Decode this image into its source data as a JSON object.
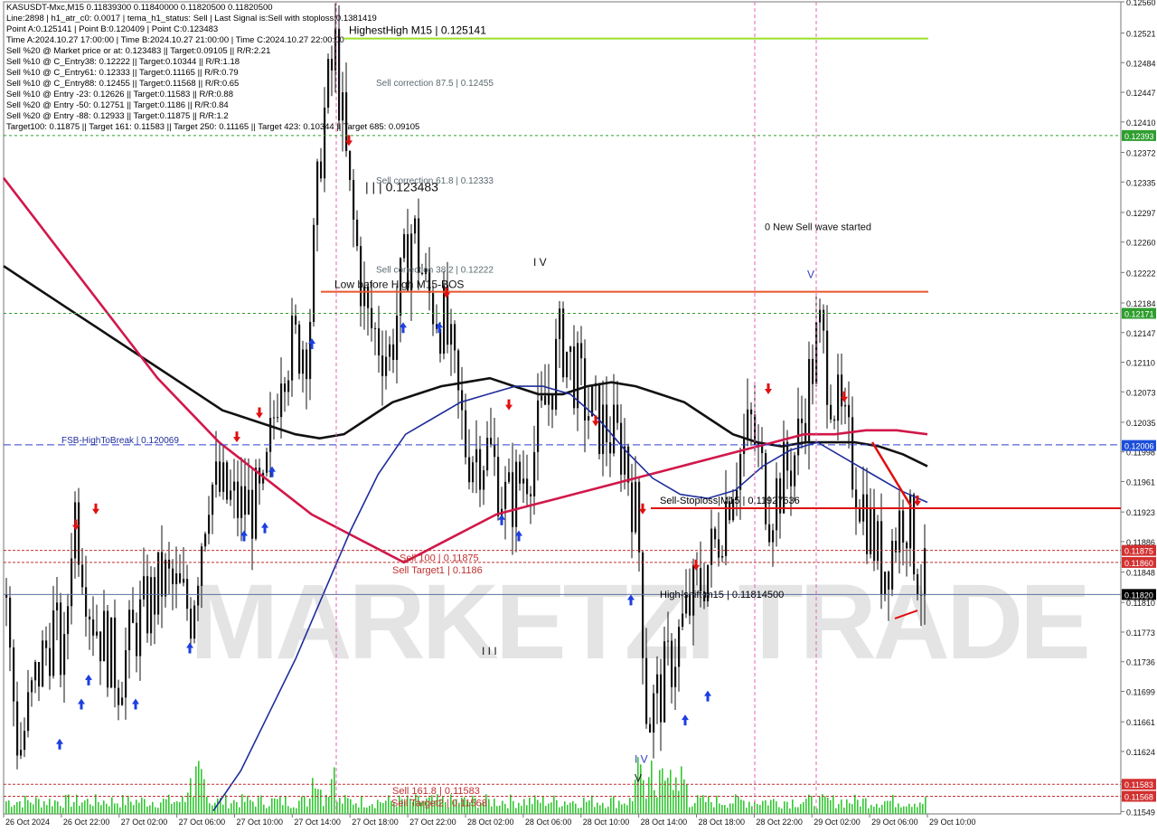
{
  "info_lines": [
    "KASUSDT-Mxc,M15  0.11839300 0.11840000 0.11820500 0.11820500",
    "Line:2898 | h1_atr_c0: 0.0017 | tema_h1_status: Sell | Last Signal is:Sell with stoploss:0.1381419",
    "Point A:0.125141 | Point B:0.120409 | Point C:0.123483",
    "Time A:2024.10.27 17:00:00 | Time B:2024.10.27 21:00:00 | Time C:2024.10.27 22:00:00",
    "Sell %20 @ Market price or at: 0.123483 || Target:0.09105 || R/R:2.21",
    "Sell %10 @ C_Entry38: 0.12222 || Target:0.10344 || R/R:1.18",
    "Sell %10 @ C_Entry61: 0.12333 || Target:0.11165 || R/R:0.79",
    "Sell %10 @ C_Entry88: 0.12455 || Target:0.11568 || R/R:0.65",
    "Sell %10 @ Entry -23: 0.12626 || Target:0.11583 || R/R:0.88",
    "Sell %20 @ Entry -50: 0.12751 || Target:0.1186 || R/R:0.84",
    "Sell %20 @ Entry -88: 0.12933 || Target:0.11875 || R/R:1.2",
    "Target100: 0.11875 || Target 161: 0.11583 || Target 250: 0.11165 || Target 423: 0.10344 || Target 685: 0.09105"
  ],
  "annotations": {
    "highest_high": "HighestHigh   M15 | 0.125141",
    "sell_corr_875": "Sell correction 87.5 | 0.12455",
    "point_c": "| | | 0.123483",
    "sell_corr_618": "Sell correction 61.8 | 0.12333",
    "sell_corr_382": "Sell correction 38.2 | 0.12222",
    "low_before_high": "Low before High   M15-BOS",
    "iv": "I V",
    "new_sell_wave": "0 New Sell wave started",
    "v_mark": "V",
    "fsb": "FSB-HighToBreak | 0.120069",
    "sell_stoploss": "Sell-Stoploss|M15 | 0.11927636",
    "sell_100": "Sell 100 | 0.11875",
    "sell_target1": "Sell Target1 | 0.1186",
    "high_shift": "High-shift m15 | 0.11814500",
    "iii": "I I I",
    "sell_1618": "Sell 161.8 | 0.11583",
    "sell_target2": "Sell Target2 | 0.11568",
    "iv_bottom": "I V",
    "v_bottom": "V",
    "watermark": "MARKETZI TRADE"
  },
  "chart_data": {
    "type": "candlestick",
    "symbol": "KASUSDT-Mxc",
    "timeframe": "M15",
    "ohlc_last": {
      "open": 0.118393,
      "high": 0.1184,
      "low": 0.118205,
      "close": 0.118205
    },
    "y_range": [
      0.11546,
      0.1256
    ],
    "y_ticks": [
      "0.12560",
      "0.12521",
      "0.12484",
      "0.12447",
      "0.12410",
      "0.12372",
      "0.12335",
      "0.12297",
      "0.12260",
      "0.12222",
      "0.12184",
      "0.12147",
      "0.12110",
      "0.12073",
      "0.12035",
      "0.11998",
      "0.11961",
      "0.11923",
      "0.11886",
      "0.11848",
      "0.11810",
      "0.11773",
      "0.11736",
      "0.11699",
      "0.11661",
      "0.11624",
      "0.11586",
      "0.11549"
    ],
    "x_ticks": [
      "26 Oct 2024",
      "26 Oct 22:00",
      "27 Oct 02:00",
      "27 Oct 06:00",
      "27 Oct 10:00",
      "27 Oct 14:00",
      "27 Oct 18:00",
      "27 Oct 22:00",
      "28 Oct 02:00",
      "28 Oct 06:00",
      "28 Oct 10:00",
      "28 Oct 14:00",
      "28 Oct 18:00",
      "28 Oct 22:00",
      "29 Oct 02:00",
      "29 Oct 06:00",
      "29 Oct 10:00"
    ],
    "price_tags": [
      {
        "label": "0.12393",
        "value": 0.12393,
        "color": "#2e9e2e"
      },
      {
        "label": "0.12171",
        "value": 0.12171,
        "color": "#2e9e2e"
      },
      {
        "label": "0.12006",
        "value": 0.12006,
        "color": "#1c4fd8"
      },
      {
        "label": "0.11875",
        "value": 0.11875,
        "color": "#d23030"
      },
      {
        "label": "0.11860",
        "value": 0.1186,
        "color": "#d23030"
      },
      {
        "label": "0.11820",
        "value": 0.1182,
        "color": "#000000"
      },
      {
        "label": "0.11583",
        "value": 0.11583,
        "color": "#d23030"
      },
      {
        "label": "0.11568",
        "value": 0.11568,
        "color": "#d23030"
      }
    ],
    "levels": [
      {
        "name": "highest-high",
        "value": 0.125141,
        "color": "#9be02a"
      },
      {
        "name": "green-dashed-upper",
        "value": 0.12393,
        "color": "#2e9e2e"
      },
      {
        "name": "low-before-high",
        "value": 0.12198,
        "color": "#e8552a"
      },
      {
        "name": "green-dashed-lower",
        "value": 0.12171,
        "color": "#2e9e2e"
      },
      {
        "name": "fsb-high-to-break",
        "value": 0.120069,
        "color": "#2d3fd0"
      },
      {
        "name": "sell-stoploss",
        "value": 0.11927636,
        "color": "#e01010"
      },
      {
        "name": "sell-100",
        "value": 0.11875,
        "color": "#c03030"
      },
      {
        "name": "sell-target1",
        "value": 0.1186,
        "color": "#c03030"
      },
      {
        "name": "current-price",
        "value": 0.1182,
        "color": "#6070a0"
      },
      {
        "name": "sell-161.8",
        "value": 0.11583,
        "color": "#c03030"
      },
      {
        "name": "sell-target2",
        "value": 0.11568,
        "color": "#c03030"
      }
    ],
    "ma_black": [
      0.1223,
      0.1221,
      0.1219,
      0.1217,
      0.1215,
      0.1213,
      0.1211,
      0.1209,
      0.1207,
      0.1205,
      0.1204,
      0.1203,
      0.1202,
      0.12015,
      0.1202,
      0.1204,
      0.1206,
      0.1207,
      0.1208,
      0.12085,
      0.1209,
      0.1208,
      0.1207,
      0.1207,
      0.1208,
      0.12085,
      0.1208,
      0.1207,
      0.1206,
      0.1204,
      0.1202,
      0.1201,
      0.12005,
      0.1201,
      0.1201,
      0.1201,
      0.12005,
      0.11995,
      0.1198
    ],
    "ma_red": [
      0.1234,
      0.1229,
      0.1224,
      0.1219,
      0.1214,
      0.1209,
      0.1205,
      0.1201,
      0.1198,
      0.1195,
      0.1192,
      0.119,
      0.1188,
      0.1186,
      0.1188,
      0.119,
      0.1192,
      0.1193,
      0.1194,
      0.1195,
      0.1196,
      0.1197,
      0.1198,
      0.1199,
      0.12,
      0.1201,
      0.1202,
      0.1202,
      0.12025,
      0.12025,
      0.1202
    ],
    "ma_blue": [
      0.1155,
      0.116,
      0.1167,
      0.1174,
      0.1182,
      0.119,
      0.1197,
      0.1202,
      0.1204,
      0.1206,
      0.1207,
      0.1208,
      0.1208,
      0.1207,
      0.1204,
      0.12,
      0.11965,
      0.11945,
      0.1194,
      0.1195,
      0.1198,
      0.12,
      0.1201,
      0.1199,
      0.1197,
      0.1195,
      0.11935
    ]
  }
}
